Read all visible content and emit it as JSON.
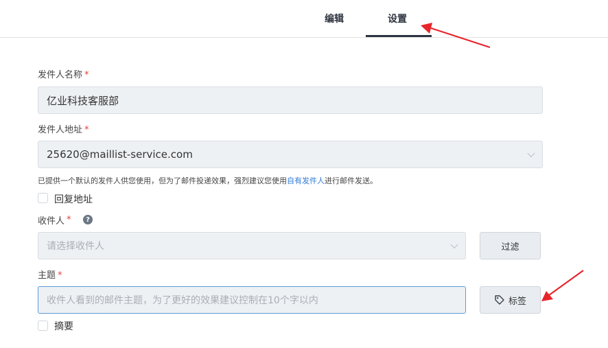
{
  "tabs": [
    {
      "label": "编辑"
    },
    {
      "label": "设置"
    }
  ],
  "sender_name": {
    "label": "发件人名称",
    "required_mark": "*",
    "value": "亿业科技客服部"
  },
  "sender_address": {
    "label": "发件人地址",
    "required_mark": "*",
    "value": "25620@maillist-service.com"
  },
  "hint": {
    "prefix": "已提供一个默认的发件人供您使用，但为了邮件投递效果，强烈建议您使用",
    "link": "自有发件人",
    "suffix": "进行邮件发送。"
  },
  "reply_address": {
    "label": "回复地址"
  },
  "recipients": {
    "label": "收件人",
    "required_mark": "*",
    "help_glyph": "?",
    "placeholder": "请选择收件人",
    "filter_button": "过滤"
  },
  "subject": {
    "label": "主题",
    "required_mark": "*",
    "placeholder": "收件人看到的邮件主题，为了更好的效果建议控制在10个字以内",
    "tag_button": "标签"
  },
  "summary": {
    "label": "摘要"
  },
  "colors": {
    "annotation_arrow": "#e8252b",
    "link": "#2e7bd6",
    "required": "#e0413b",
    "active_tab": "#2b3440"
  }
}
